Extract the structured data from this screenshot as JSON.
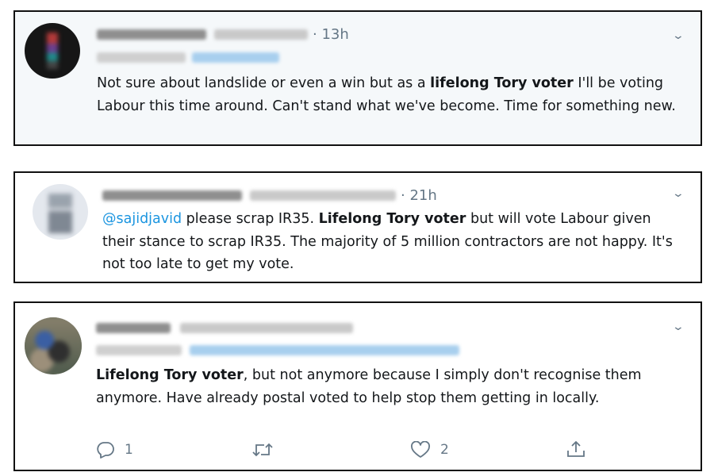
{
  "tweets": [
    {
      "time": "· 13h",
      "text_before": "Not sure about landslide or even a win but as a ",
      "text_bold": "lifelong Tory voter",
      "text_after": " I'll be voting Labour this time around. Can't stand what we've become. Time for something new."
    },
    {
      "time": "· 21h",
      "mention": "@sajidjavid",
      "text_before": " please scrap IR35. ",
      "text_bold": "Lifelong Tory voter",
      "text_after": " but will vote Labour given their stance to scrap IR35. The majority of 5 million contractors are not happy. It's not too late to get my vote."
    },
    {
      "text_bold": "Lifelong Tory voter",
      "text_after": ", but not anymore because I simply don't recognise them anymore. Have already postal voted to help stop them getting in locally.",
      "actions": {
        "reply_icon": "reply-icon",
        "reply_count": "1",
        "retweet_icon": "retweet-icon",
        "like_icon": "heart-icon",
        "like_count": "2",
        "share_icon": "share-icon"
      }
    }
  ],
  "colors": {
    "highlight_bg": "#f5f8fa",
    "mention": "#1b95e0",
    "muted": "#657786"
  }
}
